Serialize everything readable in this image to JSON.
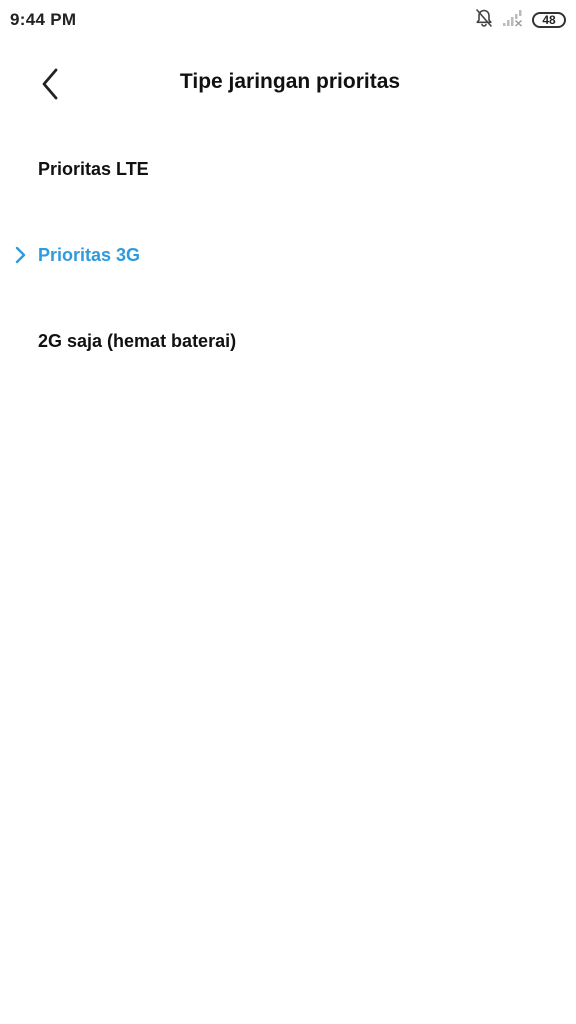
{
  "status_bar": {
    "time": "9:44 PM",
    "icons": [
      "bell-off-icon",
      "signal-no-service-icon"
    ],
    "battery": "48"
  },
  "header": {
    "back_icon": "chevron-left-icon",
    "title": "Tipe jaringan prioritas"
  },
  "options": [
    {
      "label": "Prioritas LTE",
      "selected": false
    },
    {
      "label": "Prioritas 3G",
      "selected": true
    },
    {
      "label": "2G saja (hemat baterai)",
      "selected": false
    }
  ],
  "colors": {
    "accent": "#2f9bdc",
    "text": "#111111",
    "background": "#ffffff"
  }
}
